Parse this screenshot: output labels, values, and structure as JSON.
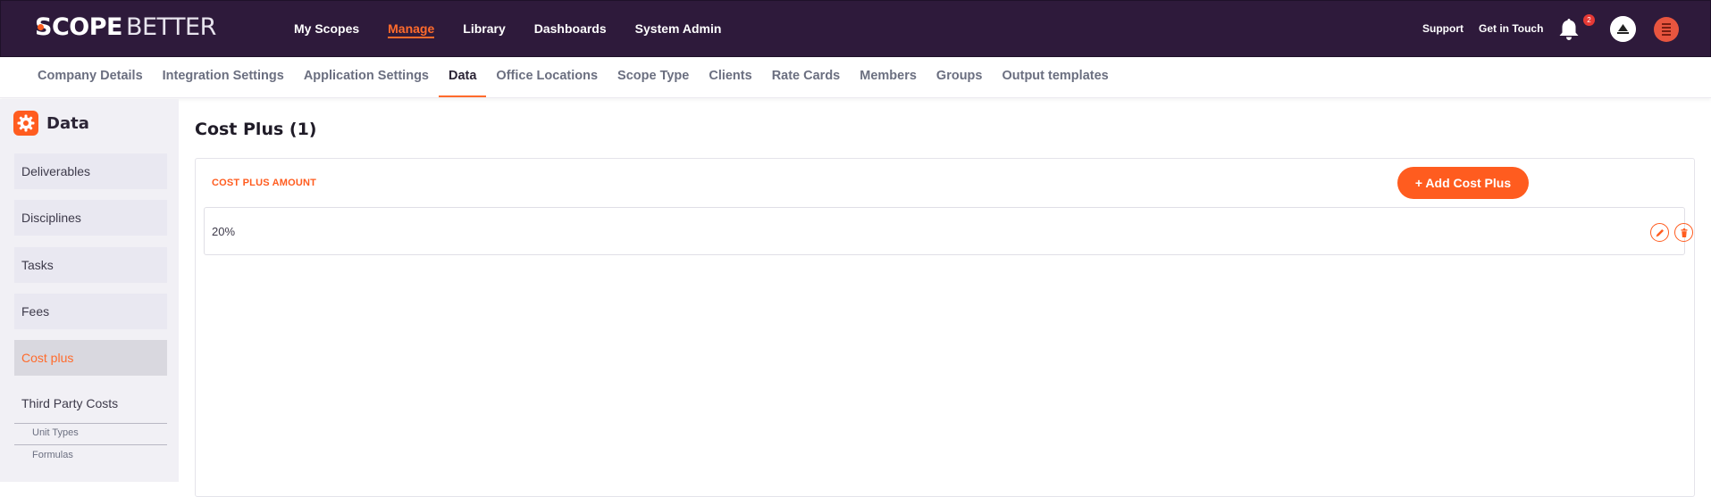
{
  "brand": {
    "scope": "SCOPE",
    "better": "BETTER"
  },
  "topnav": {
    "items": [
      {
        "label": "My Scopes",
        "active": false
      },
      {
        "label": "Manage",
        "active": true
      },
      {
        "label": "Library",
        "active": false
      },
      {
        "label": "Dashboards",
        "active": false
      },
      {
        "label": "System Admin",
        "active": false
      }
    ],
    "support": "Support",
    "contact": "Get in Touch",
    "notifications_count": "2",
    "accent": "#ff6b2c",
    "icons": [
      "bell-icon",
      "company-avatar",
      "user-avatar"
    ]
  },
  "subnav": {
    "items": [
      {
        "label": "Company Details",
        "active": false
      },
      {
        "label": "Integration Settings",
        "active": false
      },
      {
        "label": "Application Settings",
        "active": false
      },
      {
        "label": "Data",
        "active": true
      },
      {
        "label": "Office Locations",
        "active": false
      },
      {
        "label": "Scope Type",
        "active": false
      },
      {
        "label": "Clients",
        "active": false
      },
      {
        "label": "Rate Cards",
        "active": false
      },
      {
        "label": "Members",
        "active": false
      },
      {
        "label": "Groups",
        "active": false
      },
      {
        "label": "Output templates",
        "active": false
      }
    ]
  },
  "sidebar": {
    "title": "Data",
    "icon": "gear-icon",
    "items": [
      {
        "label": "Deliverables"
      },
      {
        "label": "Disciplines"
      },
      {
        "label": "Tasks"
      },
      {
        "label": "Fees"
      },
      {
        "label": "Cost plus",
        "active": true
      },
      {
        "label": "Third Party Costs"
      }
    ],
    "subitems": [
      {
        "label": "Unit Types"
      },
      {
        "label": "Formulas"
      }
    ]
  },
  "main": {
    "title": "Cost Plus (1)",
    "column_header": "COST PLUS AMOUNT",
    "add_button": "+ Add Cost Plus",
    "rows": [
      {
        "value": "20%"
      }
    ]
  }
}
